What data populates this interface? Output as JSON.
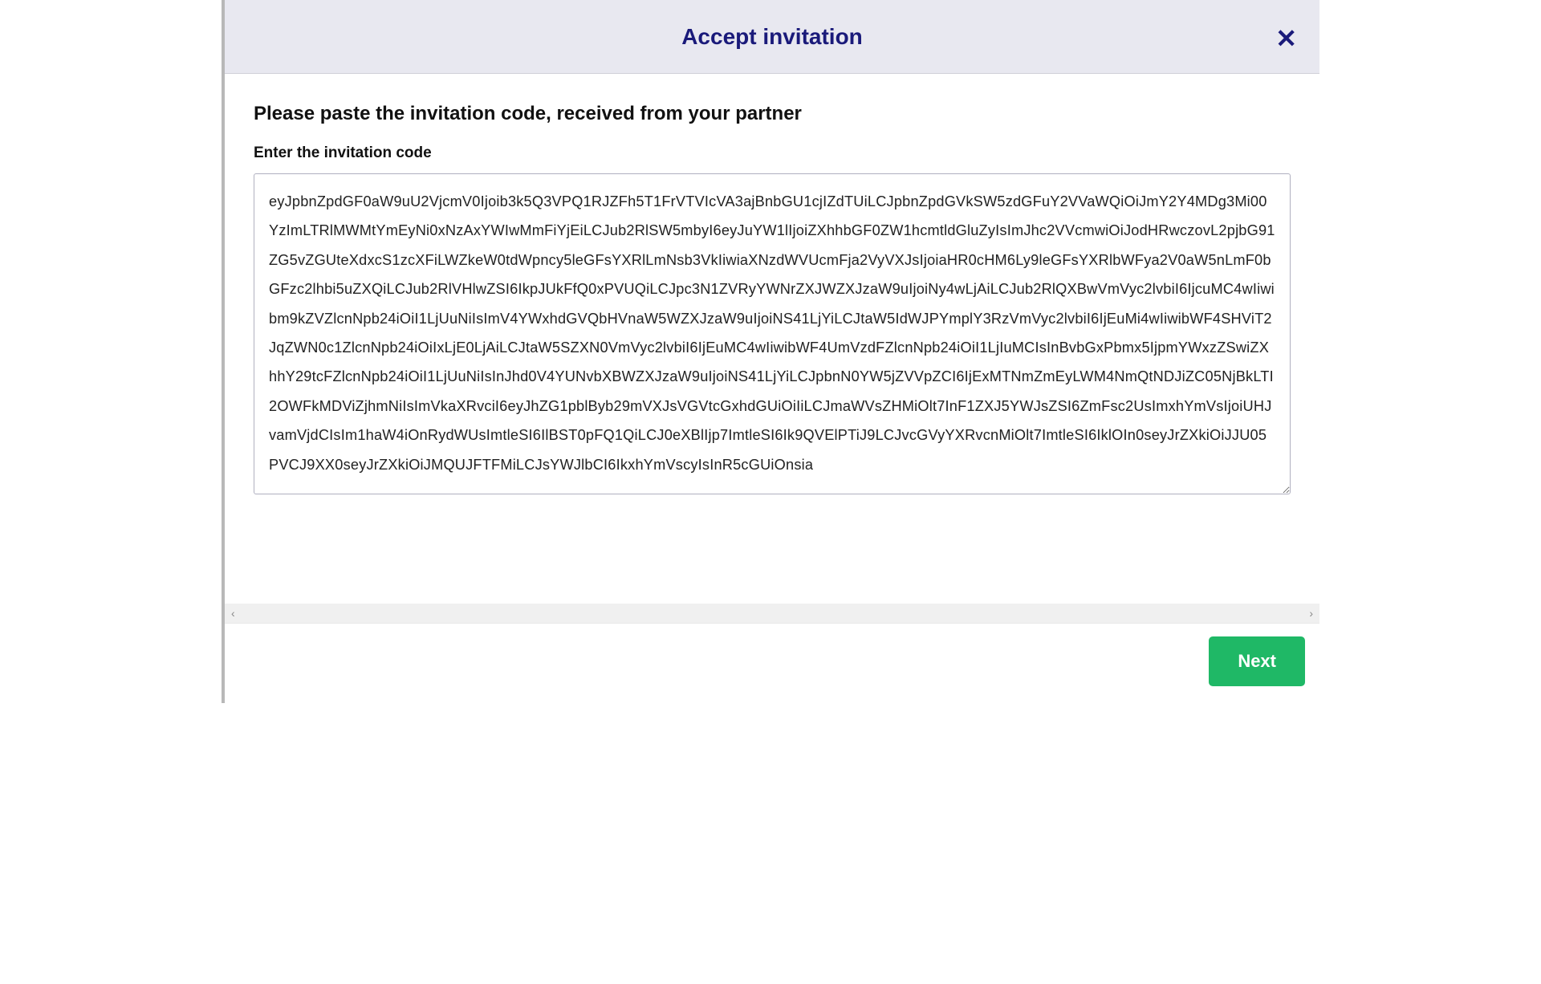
{
  "modal": {
    "title": "Accept invitation",
    "instruction": "Please paste the invitation code, received from your partner",
    "input_label": "Enter the invitation code",
    "code_value": "eyJpbnZpdGF0aW9uU2VjcmV0Ijoib3k5Q3VPQ1RJZFh5T1FrVTVIcVA3ajBnbGU1cjIZdTUiLCJpbnZpdGVkSW5zdGFuY2VVaWQiOiJmY2Y4MDg3Mi00YzImLTRlMWMtYmEyNi0xNzAxYWIwMmFiYjEiLCJub2RlSW5mbyI6eyJuYW1lIjoiZXhhbGF0ZW1hcmtldGluZyIsImJhc2VVcmwiOiJodHRwczovL2pjbG91ZG5vZGUteXdxcS1zcXFiLWZkeW0tdWpncy5leGFsYXRlLmNsb3VkIiwiaXNzdWVUcmFja2VyVXJsIjoiaHR0cHM6Ly9leGFsYXRlbWFya2V0aW5nLmF0bGFzc2lhbi5uZXQiLCJub2RlVHlwZSI6IkpJUkFfQ0xPVUQiLCJpc3N1ZVRyYWNrZXJWZXJzaW9uIjoiNy4wLjAiLCJub2RlQXBwVmVyc2lvbiI6IjcuMC4wIiwibm9kZVZlcnNpb24iOiI1LjUuNiIsImV4YWxhdGVQbHVnaW5WZXJzaW9uIjoiNS41LjYiLCJtaW5IdWJPYmplY3RzVmVyc2lvbiI6IjEuMi4wIiwibWF4SHViT2JqZWN0c1ZlcnNpb24iOiIxLjE0LjAiLCJtaW5SZXN0VmVyc2lvbiI6IjEuMC4wIiwibWF4UmVzdFZlcnNpb24iOiI1LjIuMCIsInBvbGxPbmx5IjpmYWxzZSwiZXhhY29tcFZlcnNpb24iOiI1LjUuNiIsInJhd0V4YUNvbXBWZXJzaW9uIjoiNS41LjYiLCJpbnN0YW5jZVVpZCI6IjExMTNmZmEyLWM4NmQtNDJiZC05NjBkLTI2OWFkMDViZjhmNiIsImVkaXRvciI6eyJhZG1pblByb29mVXJsVGVtcGxhdGUiOiIiLCJmaWVsZHMiOlt7InF1ZXJ5YWJsZSI6ZmFsc2UsImxhYmVsIjoiUHJvamVjdCIsIm1haW4iOnRydWUsImtleSI6IlBST0pFQ1QiLCJ0eXBlIjp7ImtleSI6Ik9QVElPTiJ9LCJvcGVyYXRvcnMiOlt7ImtleSI6IklOIn0seyJrZXkiOiJJU05PVCJ9XX0seyJrZXkiOiJMQUJFTFMiLCJsYWJlbCI6IkxhYmVscyIsInR5cGUiOnsia",
    "next_label": "Next"
  }
}
